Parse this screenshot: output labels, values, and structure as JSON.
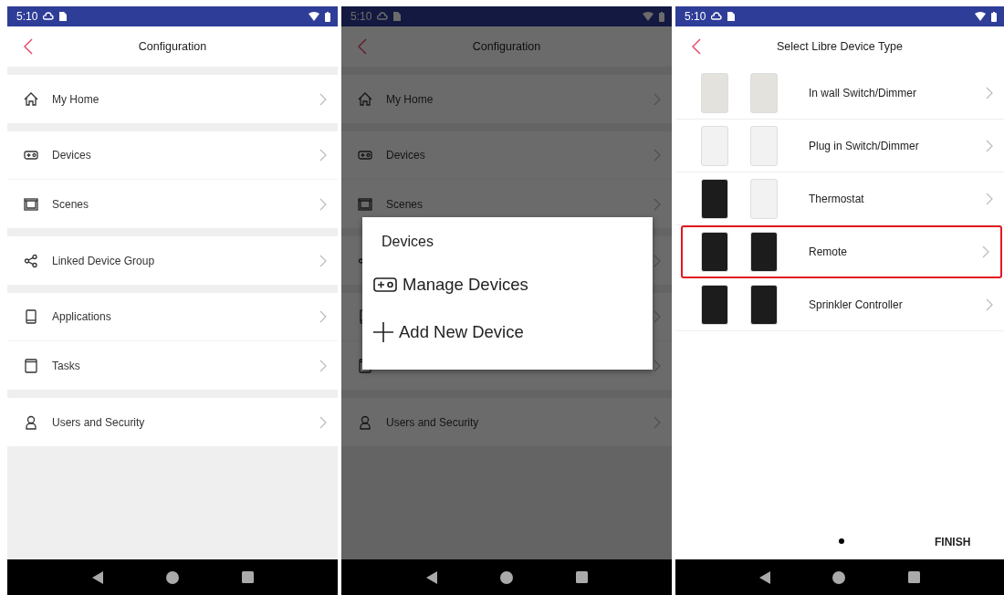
{
  "screens": [
    {
      "kind": "menu",
      "dimmed": false,
      "status_bar": {
        "time": "5:10"
      },
      "title": "Configuration",
      "groups": [
        [
          {
            "label": "My Home"
          }
        ],
        [
          {
            "label": "Devices"
          },
          {
            "label": "Scenes"
          }
        ],
        [
          {
            "label": "Linked Device Group"
          }
        ],
        [
          {
            "label": "Applications"
          },
          {
            "label": "Tasks"
          }
        ],
        [
          {
            "label": "Users and Security"
          }
        ]
      ]
    },
    {
      "kind": "menu",
      "dimmed": true,
      "status_bar": {
        "time": "5:10"
      },
      "title": "Configuration",
      "groups": [
        [
          {
            "label": "My Home"
          }
        ],
        [
          {
            "label": "Devices"
          },
          {
            "label": "Scenes"
          }
        ],
        [
          {
            "covered": true
          }
        ],
        [
          {
            "covered": true
          },
          {
            "covered": true
          }
        ],
        [
          {
            "label": "Users and Security"
          }
        ]
      ],
      "dialog": {
        "title": "Devices",
        "items": [
          {
            "label": "Manage Devices"
          },
          {
            "label": "Add New Device"
          }
        ]
      }
    },
    {
      "kind": "device_types",
      "dimmed": false,
      "status_bar": {
        "time": "5:10"
      },
      "title": "Select Libre Device Type",
      "items": [
        {
          "label": "In wall Switch/Dimmer",
          "selected": false
        },
        {
          "label": "Plug in Switch/Dimmer",
          "selected": false
        },
        {
          "label": "Thermostat",
          "selected": false
        },
        {
          "label": "Remote",
          "selected": true
        },
        {
          "label": "Sprinkler Controller",
          "selected": false
        }
      ],
      "finish": "FINISH"
    }
  ]
}
